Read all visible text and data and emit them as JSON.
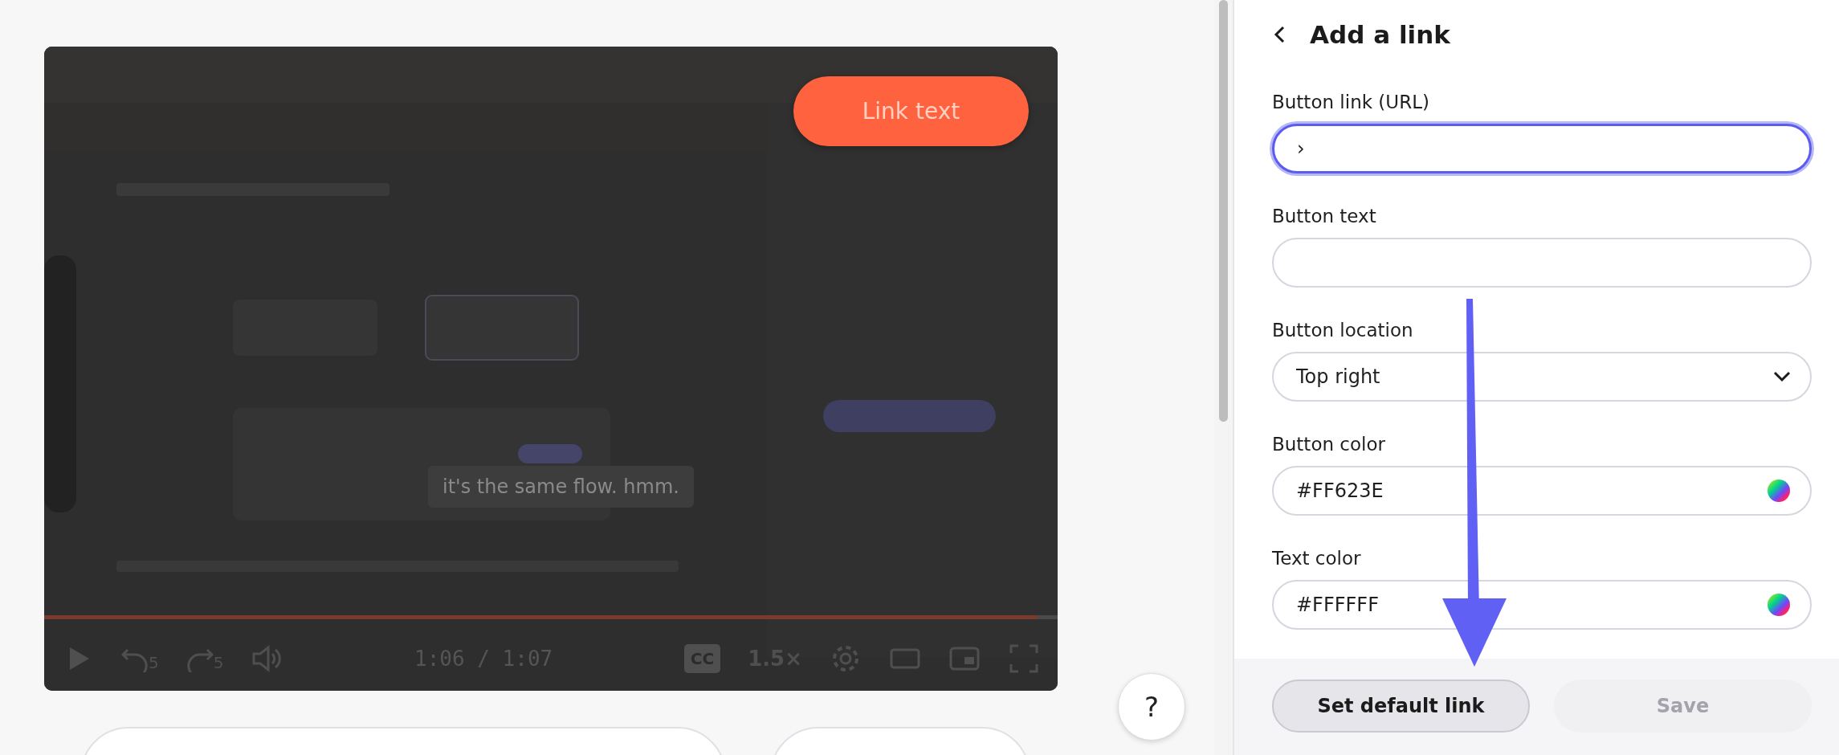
{
  "video": {
    "kind": "picture",
    "link_button": {
      "label": "Link text"
    },
    "caption": "it's the same flow. hmm.",
    "progress": {
      "level": 0.98
    },
    "controls": {
      "rewind_seconds": "5",
      "forward_seconds": "5",
      "time": "1:06 / 1:07",
      "captions": "CC",
      "speed": "1.5×"
    }
  },
  "help_button": "?",
  "panel": {
    "title": "Add a link",
    "fields": [
      {
        "label": "Button link (URL)",
        "kind": "text",
        "value": "›",
        "focused": true
      },
      {
        "label": "Button text",
        "kind": "text",
        "focused": false
      },
      {
        "label": "Button location",
        "kind": "select",
        "value": "Top right",
        "focused": false
      },
      {
        "label": "Button color",
        "kind": "color",
        "value": "#FF623E",
        "focused": false
      },
      {
        "label": "Text color",
        "kind": "color",
        "value": "#FFFFFF",
        "focused": false
      }
    ],
    "buttons": [
      {
        "label": "Set default link",
        "disabled": false
      },
      {
        "label": "Save",
        "disabled": true
      }
    ]
  }
}
